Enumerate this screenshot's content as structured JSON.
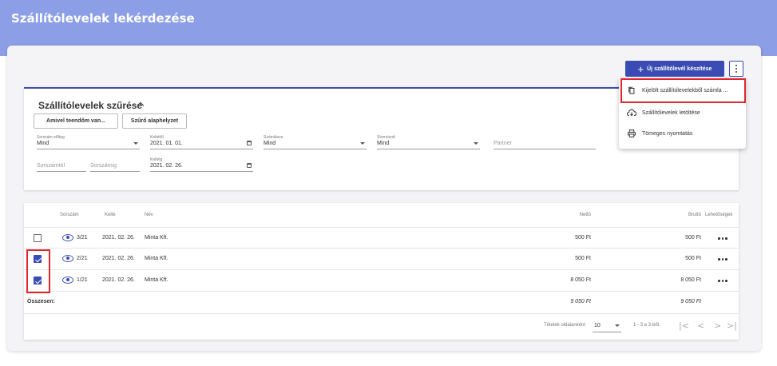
{
  "page": {
    "title": "Szállítólevelek lekérdezése"
  },
  "toolbar": {
    "new_button_label": "Új szállítólevél készítése",
    "new_button_icon": "plus-icon",
    "more_icon": "more-vert-icon"
  },
  "menu": {
    "items": [
      {
        "label": "Kijelölt szállítólevelekből számla ...",
        "icon": "copy-document-icon"
      },
      {
        "label": "Szállítólevelek letöltése",
        "icon": "cloud-download-icon"
      },
      {
        "label": "Tömeges nyomtatás",
        "icon": "printer-icon"
      }
    ]
  },
  "filter": {
    "title": "Szállítólevelek szűrése",
    "btn_todo": "Amivel teendőm van...",
    "btn_reset": "Szűrő alaphelyzet",
    "prefix": {
      "label": "Sorszám előtag",
      "value": "Mind"
    },
    "date_from": {
      "label": "Keltétől",
      "value": "2021. 01. 01."
    },
    "invoiced": {
      "label": "Számlázva",
      "value": "Mind"
    },
    "cancelled": {
      "label": "Stornózott",
      "value": "Mind"
    },
    "partner": {
      "placeholder": "Partner"
    },
    "serial_from": {
      "placeholder": "Sorszámtól"
    },
    "serial_to": {
      "placeholder": "Sorszámig"
    },
    "date_to": {
      "label": "Keltéig",
      "value": "2021. 02. 26."
    }
  },
  "table": {
    "headers": {
      "serial": "Sorszám",
      "date": "Kelte",
      "name": "Név",
      "net": "Nettó",
      "gross": "Bruttó",
      "options": "Lehetőségek"
    },
    "rows": [
      {
        "serial": "3/21",
        "date": "2021. 02. 26.",
        "name": "Minta Kft.",
        "net": "500 Ft",
        "gross": "500 Ft",
        "checked": false
      },
      {
        "serial": "2/21",
        "date": "2021. 02. 26.",
        "name": "Minta Kft.",
        "net": "500 Ft",
        "gross": "500 Ft",
        "checked": true
      },
      {
        "serial": "1/21",
        "date": "2021. 02. 26.",
        "name": "Minta Kft.",
        "net": "8 050 Ft",
        "gross": "8 050 Ft",
        "checked": true
      }
    ],
    "total": {
      "label": "Összesen:",
      "net": "9 050 Ft",
      "gross": "9 050 Ft"
    }
  },
  "pagination": {
    "per_page_label": "Tételek oldalanként",
    "per_page_value": "10",
    "range": "1 - 3 a 3-ből.",
    "first": "|<",
    "prev": "<",
    "next": ">",
    "last": ">|"
  },
  "colors": {
    "primary": "#3a4cb3",
    "header": "#8c9fe6",
    "highlight": "#e0262f"
  }
}
